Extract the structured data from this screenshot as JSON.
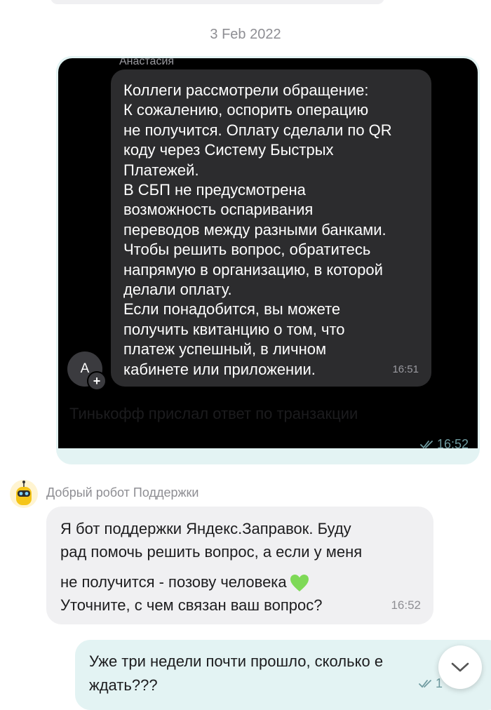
{
  "date_separator": "3 Feb 2022",
  "outgoing_screenshot_message": {
    "screenshot": {
      "sender_name": "Анастасия",
      "avatar_letter": "А",
      "avatar_badge": "+",
      "message_text": "Коллеги рассмотрели обращение:\nК сожалению, оспорить операцию\nне получится. Оплату сделали по QR\nкоду через Систему Быстрых\nПлатежей.\nВ СБП не предусмотрена\nвозможность оспаривания\nпереводов между разными банками.\nЧтобы решить вопрос, обратитесь\nнапрямую в организацию, в которой\nделали оплату.\nЕсли понадобится, вы можете\nполучить квитанцию о том, что\nплатеж успешный, в личном\nкабинете или приложении.",
      "message_time": "16:51"
    },
    "caption": "Тинькофф прислал ответ по транзакции",
    "time": "16:52"
  },
  "bot_message": {
    "sender_name": "Добрый робот Поддержки",
    "lines": [
      "Я бот поддержки Яндекс.Заправок. Буду",
      "рад помочь решить вопрос, а если у меня",
      "не получится - позову человека",
      "Уточните, с чем связан ваш вопрос?"
    ],
    "emoji": "green-heart-icon",
    "time": "16:52"
  },
  "outgoing_message_2": {
    "line1": "Уже три недели почти прошло, сколько е",
    "line2": "ждать???",
    "time_partial": "1"
  },
  "colors": {
    "outgoing_bubble": "#e3f3f3",
    "incoming_bubble": "#f0f0f2",
    "heart": "#7ed957"
  }
}
